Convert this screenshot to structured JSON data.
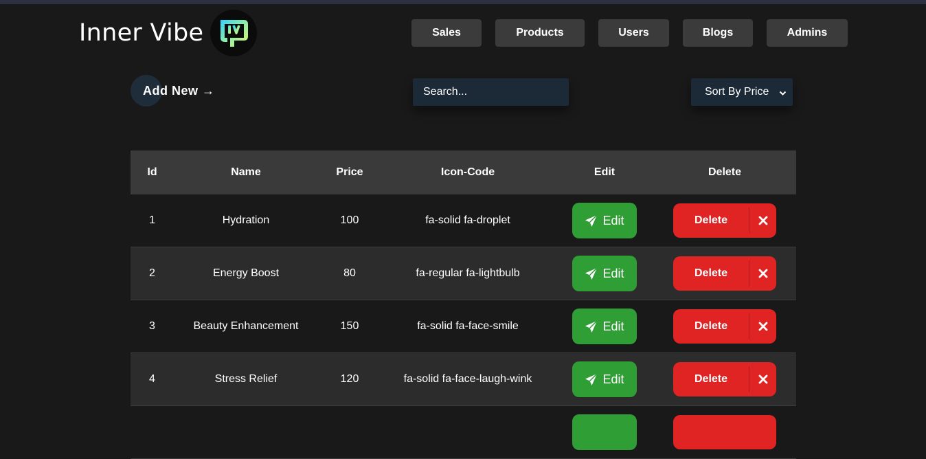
{
  "brand": {
    "name": "Inner Vibe",
    "logo_icon": "iv-logo-icon"
  },
  "nav": [
    {
      "label": "Sales"
    },
    {
      "label": "Products"
    },
    {
      "label": "Users"
    },
    {
      "label": "Blogs"
    },
    {
      "label": "Admins"
    }
  ],
  "toolbar": {
    "add_new_label": "Add New →",
    "search_placeholder": "Search...",
    "sort_label": "Sort By Price"
  },
  "table": {
    "headers": [
      "Id",
      "Name",
      "Price",
      "Icon-Code",
      "Edit",
      "Delete"
    ],
    "rows": [
      {
        "id": "1",
        "name": "Hydration",
        "price": "100",
        "icon_code": "fa-solid fa-droplet"
      },
      {
        "id": "2",
        "name": "Energy Boost",
        "price": "80",
        "icon_code": "fa-regular fa-lightbulb"
      },
      {
        "id": "3",
        "name": "Beauty Enhancement",
        "price": "150",
        "icon_code": "fa-solid fa-face-smile"
      },
      {
        "id": "4",
        "name": "Stress Relief",
        "price": "120",
        "icon_code": "fa-solid fa-face-laugh-wink"
      }
    ],
    "edit_label": "Edit",
    "delete_label": "Delete"
  },
  "colors": {
    "background": "#191919",
    "header_bg": "#3a3a3a",
    "row_alt_bg": "#2c2c2c",
    "nav_button_bg": "#3b3b3b",
    "input_bg": "#1c2937",
    "edit_green": "#2f9e35",
    "delete_red": "#e02424"
  }
}
